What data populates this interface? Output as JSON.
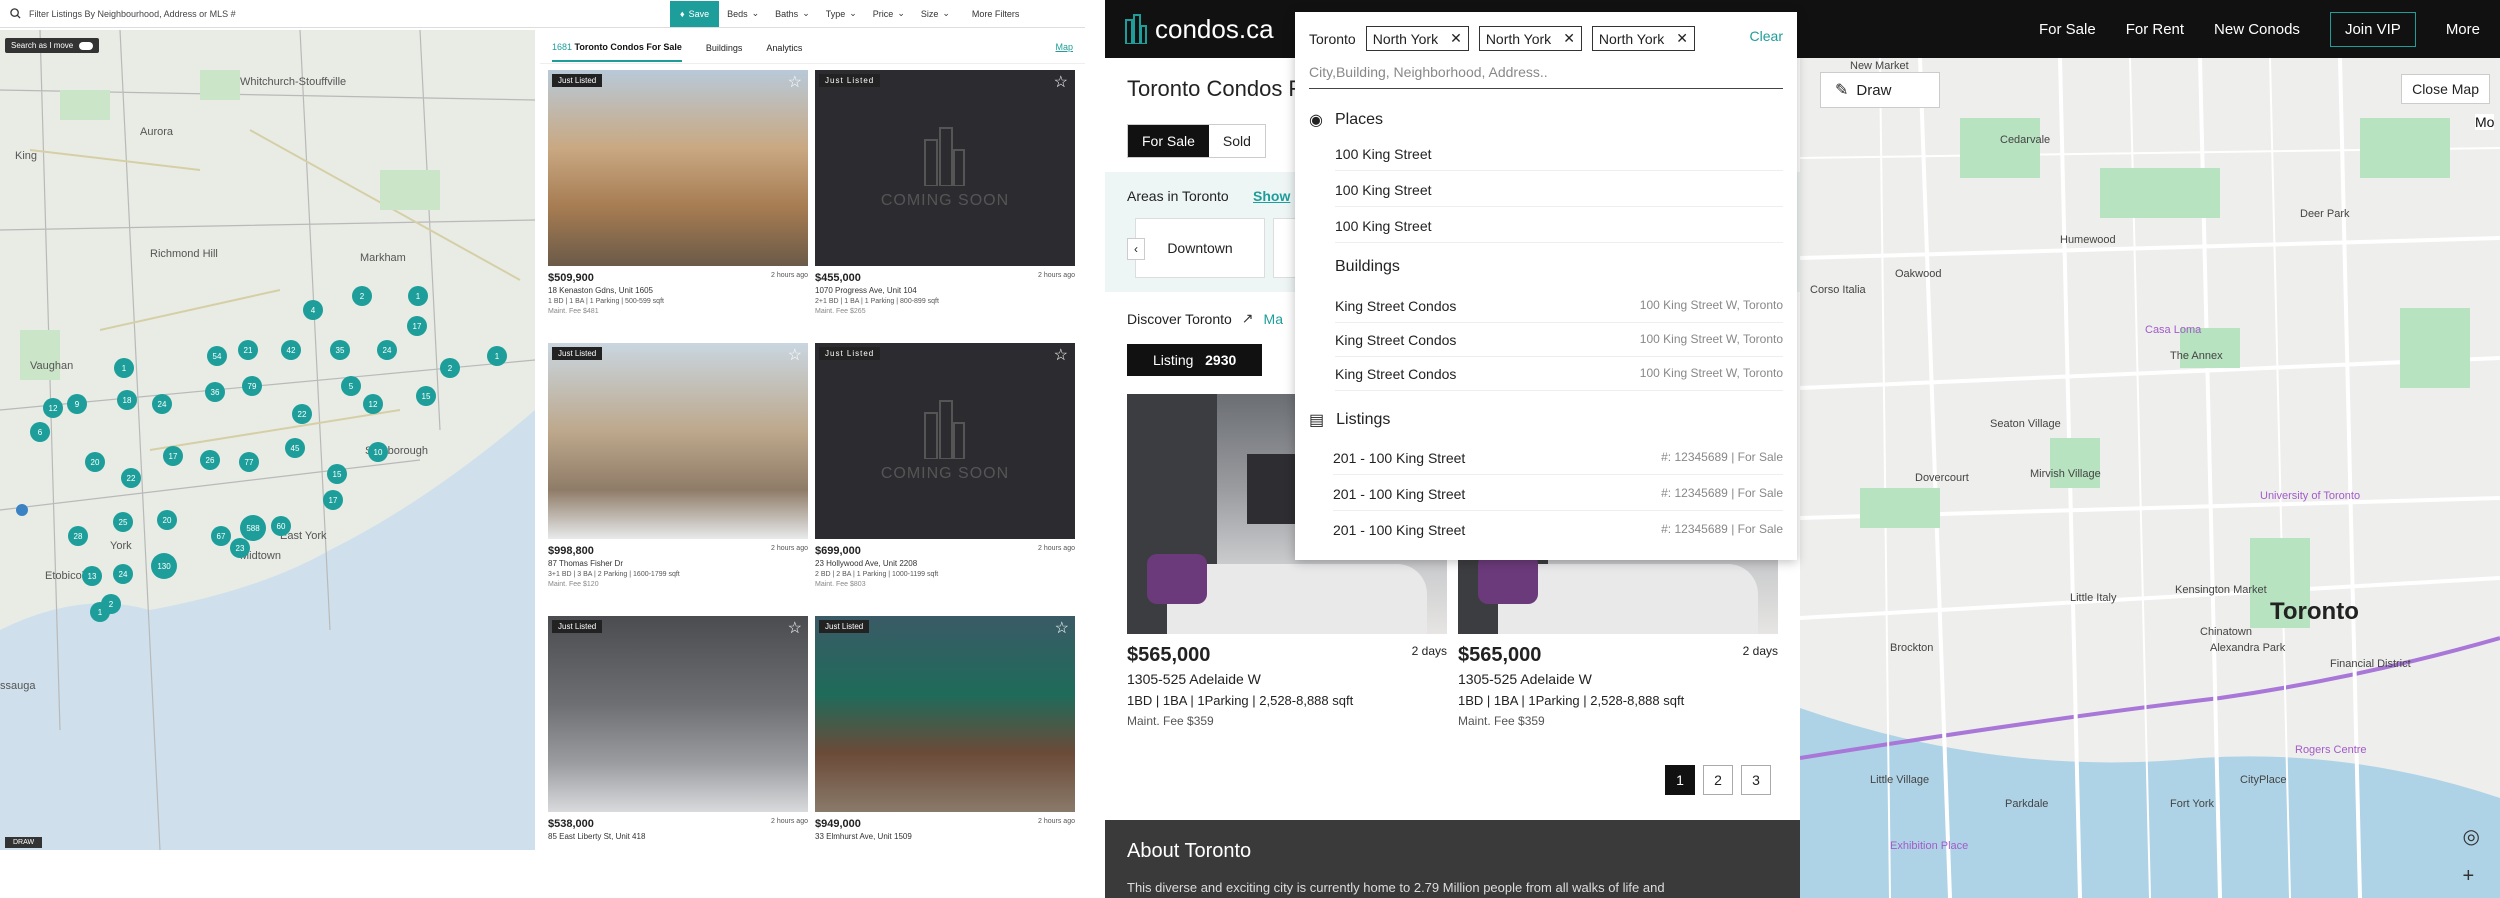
{
  "left": {
    "search_placeholder": "Filter Listings By Neighbourhood, Address or MLS #",
    "save_label": "Save",
    "filters": [
      "Beds",
      "Baths",
      "Type",
      "Price",
      "Size"
    ],
    "more_filters": "More Filters",
    "search_as_i_move": "Search as I move",
    "draw_label": "DRAW",
    "tabs": {
      "count": "1681",
      "main": "Toronto Condos For Sale",
      "buildings": "Buildings",
      "analytics": "Analytics",
      "map": "Map"
    },
    "map_labels": [
      "Aurora",
      "Whitchurch-Stouffville",
      "King",
      "Richmond Hill",
      "Markham",
      "Vaughan",
      "Scarborough",
      "East York",
      "Etobicoke",
      "Midtown",
      "York",
      "ssauga"
    ],
    "clusters": [
      "2",
      "1",
      "4",
      "17",
      "1",
      "54",
      "21",
      "42",
      "35",
      "24",
      "2",
      "1",
      "79",
      "5",
      "22",
      "12",
      "15",
      "12",
      "9",
      "18",
      "24",
      "36",
      "6",
      "20",
      "17",
      "26",
      "77",
      "45",
      "10",
      "22",
      "15",
      "17",
      "28",
      "25",
      "20",
      "67",
      "588",
      "60",
      "23",
      "13",
      "24",
      "130",
      "2",
      "1"
    ],
    "listings": [
      {
        "badge": "Just Listed",
        "price": "$509,900",
        "time": "2 hours ago",
        "address": "18 Kenaston Gdns, Unit 1605",
        "specs": "1 BD | 1 BA | 1 Parking | 500-599 sqft",
        "fee": "Maint. Fee $481",
        "coming_soon": false
      },
      {
        "badge": "Just Listed",
        "price": "$455,000",
        "time": "2 hours ago",
        "address": "1070 Progress Ave, Unit 104",
        "specs": "2+1 BD | 1 BA | 1 Parking | 800-899 sqft",
        "fee": "Maint. Fee $265",
        "coming_soon": true
      },
      {
        "badge": "Just Listed",
        "price": "$998,800",
        "time": "2 hours ago",
        "address": "87 Thomas Fisher Dr",
        "specs": "3+1 BD | 3 BA | 2 Parking | 1600-1799 sqft",
        "fee": "Maint. Fee $120",
        "coming_soon": false
      },
      {
        "badge": "Just Listed",
        "price": "$699,000",
        "time": "2 hours ago",
        "address": "23 Hollywood Ave, Unit 2208",
        "specs": "2 BD | 2 BA | 1 Parking | 1000-1199 sqft",
        "fee": "Maint. Fee $803",
        "coming_soon": true
      },
      {
        "badge": "Just Listed",
        "price": "$538,000",
        "time": "2 hours ago",
        "address": "85 East Liberty St, Unit 418",
        "specs": "",
        "fee": "",
        "coming_soon": false
      },
      {
        "badge": "Just Listed",
        "price": "$949,000",
        "time": "2 hours ago",
        "address": "33 Elmhurst Ave, Unit 1509",
        "specs": "",
        "fee": "",
        "coming_soon": false
      }
    ],
    "coming_soon_text": "COMING SOON"
  },
  "right": {
    "logo": "condos.ca",
    "nav": [
      "For Sale",
      "For Rent",
      "New Conods",
      "Join VIP",
      "More"
    ],
    "title": "Toronto Condos F",
    "segment": [
      "For Sale",
      "Sold"
    ],
    "areas_label": "Areas in Toronto",
    "areas_show": "Show",
    "area_chip": "Downtown",
    "discover": "Discover Toronto",
    "discover_link": "Ma",
    "listing_btn_label": "Listing",
    "listing_btn_count": "2930",
    "cards": [
      {
        "price": "$565,000",
        "time": "2 days",
        "address": "1305-525 Adelaide W",
        "specs": "1BD  |  1BA  |  1Parking  |  2,528-8,888 sqft",
        "fee": "Maint. Fee $359"
      },
      {
        "price": "$565,000",
        "time": "2 days",
        "address": "1305-525 Adelaide W",
        "specs": "1BD  |  1BA  |  1Parking  |  2,528-8,888 sqft",
        "fee": "Maint. Fee $359"
      }
    ],
    "pages": [
      "1",
      "2",
      "3"
    ],
    "about_title": "About Toronto",
    "about_text": "This diverse and exciting city is currently home to 2.79 Million people from all walks of life and",
    "map": {
      "close_map": "Close Map",
      "draw": "Draw",
      "labels": [
        "New Market",
        "Cedarvale",
        "Humewood",
        "Deer Park",
        "Oakwood",
        "Corso Italia",
        "Casa Loma",
        "The Annex",
        "Seaton Village",
        "Dovercourt",
        "Mirvish Village",
        "University of Toronto",
        "Little Italy",
        "Kensington Market",
        "Chinatown",
        "Brockton",
        "Alexandra Park",
        "Financial District",
        "Rogers Centre",
        "Little Village",
        "Parkdale",
        "Fort York",
        "CityPlace",
        "Exhibition Place",
        "Toronto",
        "Mo"
      ]
    }
  },
  "dropdown": {
    "city": "Toronto",
    "tags": [
      "North York",
      "North York",
      "North York"
    ],
    "clear": "Clear",
    "placeholder": "City,Building, Neighborhood, Address..",
    "places_title": "Places",
    "places": [
      "100 King Street",
      "100 King Street",
      "100 King Street"
    ],
    "buildings_title": "Buildings",
    "buildings": [
      {
        "name": "King Street Condos",
        "addr": "100 King Street W, Toronto"
      },
      {
        "name": "King Street Condos",
        "addr": "100 King Street W, Toronto"
      },
      {
        "name": "King Street Condos",
        "addr": "100 King Street W, Toronto"
      }
    ],
    "listings_title": "Listings",
    "listings": [
      {
        "name": "201 - 100 King Street",
        "meta": "#: 12345689  |  For Sale"
      },
      {
        "name": "201 - 100 King Street",
        "meta": "#: 12345689  |  For Sale"
      },
      {
        "name": "201 - 100 King Street",
        "meta": "#: 12345689  |  For Sale"
      }
    ]
  }
}
